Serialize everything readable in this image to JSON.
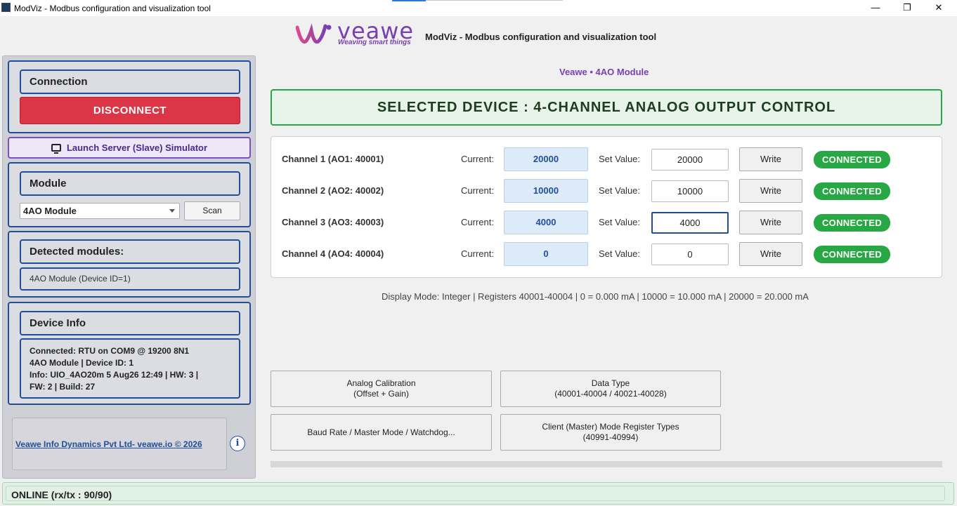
{
  "window": {
    "title": "ModViz - Modbus configuration and visualization tool",
    "minimize_glyph": "—",
    "maximize_glyph": "❐",
    "close_glyph": "✕"
  },
  "header": {
    "brand": "veawe",
    "tagline": "Weaving smart things",
    "title": "ModViz - Modbus configuration and visualization tool",
    "brand_color": "#7a3fb0"
  },
  "sidebar": {
    "connection": {
      "heading": "Connection",
      "disconnect_label": "DISCONNECT"
    },
    "launch_label": "Launch Server (Slave) Simulator",
    "module": {
      "heading": "Module",
      "selected": "4AO Module",
      "scan_label": "Scan"
    },
    "detected": {
      "heading": "Detected modules:",
      "items": [
        "4AO Module (Device ID=1)"
      ]
    },
    "device_info": {
      "heading": "Device Info",
      "lines": [
        "Connected: RTU on COM9 @ 19200 8N1",
        "4AO Module | Device ID: 1",
        "Info: UIO_4AO20m  5 Aug26 12:49 | HW: 3 |",
        "FW: 2 | Build: 27"
      ]
    },
    "footer_link": "Veawe Info Dynamics Pvt Ltd- veawe.io © 2026",
    "info_glyph": "i"
  },
  "main": {
    "subheading": "Veawe • 4AO Module",
    "banner": "SELECTED DEVICE : 4-CHANNEL ANALOG OUTPUT CONTROL",
    "current_label": "Current:",
    "set_label": "Set Value:",
    "write_label": "Write",
    "channels": [
      {
        "label": "Channel 1 (AO1: 40001)",
        "current": "20000",
        "set": "20000",
        "status": "CONNECTED"
      },
      {
        "label": "Channel 2 (AO2: 40002)",
        "current": "10000",
        "set": "10000",
        "status": "CONNECTED"
      },
      {
        "label": "Channel 3 (AO3: 40003)",
        "current": "4000",
        "set": "4000",
        "status": "CONNECTED"
      },
      {
        "label": "Channel 4 (AO4: 40004)",
        "current": "0",
        "set": "0",
        "status": "CONNECTED"
      }
    ],
    "display_mode": "Display Mode: Integer  |  Registers 40001-40004  |  0 = 0.000 mA  |  10000 = 10.000 mA  |  20000 = 20.000 mA",
    "buttons": [
      {
        "line1": "Analog Calibration",
        "line2": "(Offset + Gain)"
      },
      {
        "line1": "Data Type",
        "line2": "(40001-40004 / 40021-40028)"
      },
      {
        "line1": "Baud Rate / Master Mode / Watchdog...",
        "line2": ""
      },
      {
        "line1": "Client (Master) Mode Register Types",
        "line2": "(40991-40994)"
      }
    ]
  },
  "statusbar": {
    "text": "ONLINE (rx/tx : 90/90)",
    "color": "#e2f1e6"
  },
  "colors": {
    "primary": "#1f4f99",
    "danger": "#dc3545",
    "success": "#28a745"
  }
}
